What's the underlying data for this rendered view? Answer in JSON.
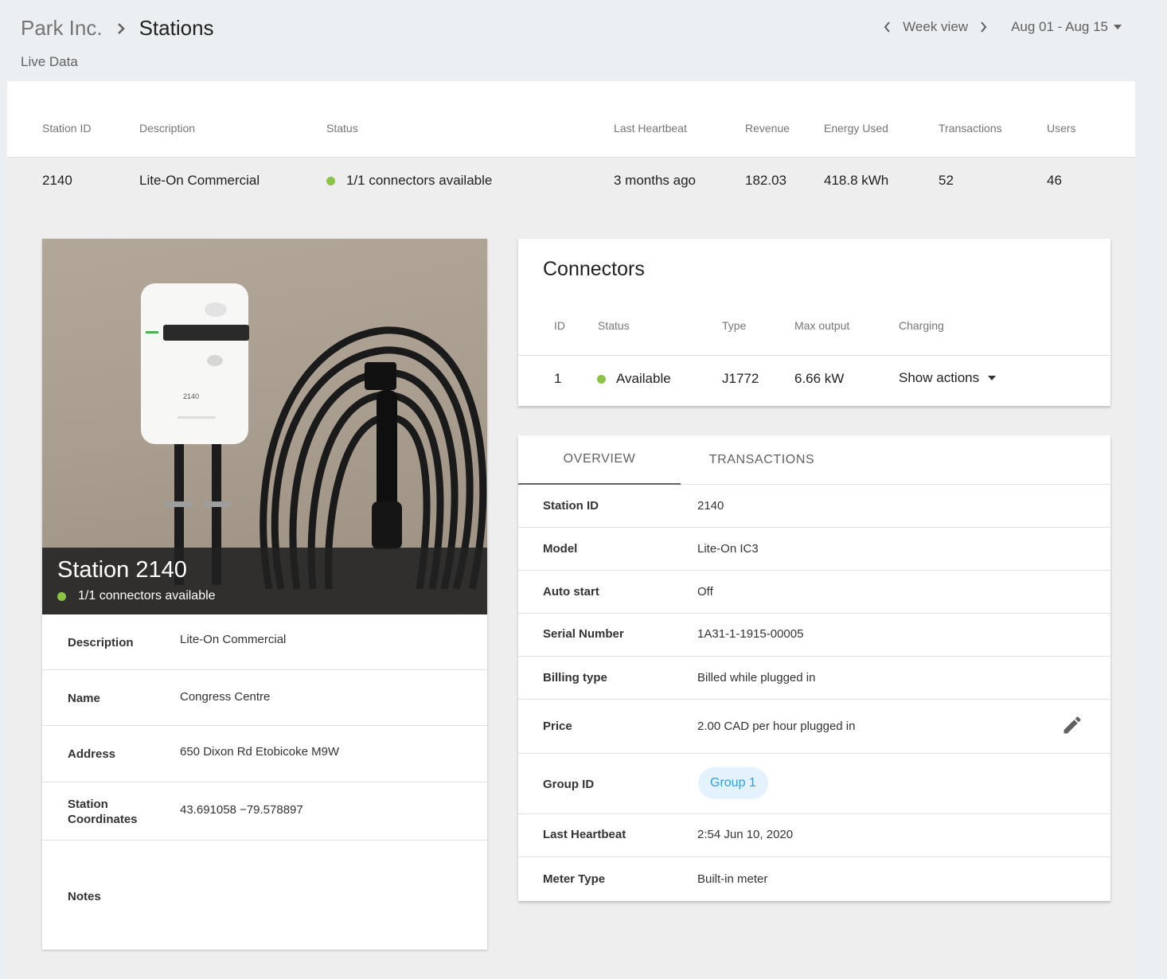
{
  "header": {
    "breadcrumb_parent": "Park Inc.",
    "breadcrumb_current": "Stations",
    "subtitle": "Live Data",
    "week_view_label": "Week view",
    "date_range": "Aug 01 - Aug 15"
  },
  "stations_table": {
    "columns": [
      "Station ID",
      "Description",
      "Status",
      "Last Heartbeat",
      "Revenue",
      "Energy Used",
      "Transactions",
      "Users"
    ],
    "row": {
      "station_id": "2140",
      "description": "Lite-On Commercial",
      "status": "1/1 connectors available",
      "last_heartbeat": "3 months ago",
      "revenue": "182.03",
      "energy_used": "418.8 kWh",
      "transactions": "52",
      "users": "46"
    }
  },
  "station_card": {
    "title": "Station 2140",
    "status": "1/1 connectors available",
    "device_label": "2140",
    "fields": [
      {
        "label": "Description",
        "value": "Lite-On Commercial"
      },
      {
        "label": "Name",
        "value": "Congress Centre"
      },
      {
        "label": "Address",
        "value": "650 Dixon Rd Etobicoke M9W"
      },
      {
        "label": "Station Coordinates",
        "value": "43.691058 −79.578897"
      },
      {
        "label": "Notes",
        "value": ""
      }
    ]
  },
  "connectors": {
    "title": "Connectors",
    "columns": [
      "ID",
      "Status",
      "Type",
      "Max output",
      "Charging"
    ],
    "rows": [
      {
        "id": "1",
        "status": "Available",
        "type": "J1772",
        "max_output": "6.66 kW",
        "charging": "Show actions"
      }
    ]
  },
  "details": {
    "tabs": [
      "OVERVIEW",
      "TRANSACTIONS"
    ],
    "active_tab": "OVERVIEW",
    "fields": [
      {
        "label": "Station ID",
        "value": "2140"
      },
      {
        "label": "Model",
        "value": "Lite-On IC3"
      },
      {
        "label": "Auto start",
        "value": "Off"
      },
      {
        "label": "Serial Number",
        "value": "1A31-1-1915-00005"
      },
      {
        "label": "Billing type",
        "value": "Billed while plugged in"
      },
      {
        "label": "Price",
        "value": "2.00 CAD per hour plugged in"
      },
      {
        "label": "Group ID",
        "value": "Group 1"
      },
      {
        "label": "Last Heartbeat",
        "value": "2:54 Jun 10, 2020"
      },
      {
        "label": "Meter Type",
        "value": "Built-in meter"
      }
    ]
  },
  "icons": {
    "breadcrumb_separator": "chevron-right-icon",
    "prev": "chevron-left-icon",
    "next": "chevron-right-icon",
    "dropdown": "caret-down-icon",
    "edit": "pencil-icon"
  },
  "colors": {
    "status_available": "#8bc34a",
    "chip_background": "#e3f2fd",
    "chip_text": "#29a3dd"
  }
}
